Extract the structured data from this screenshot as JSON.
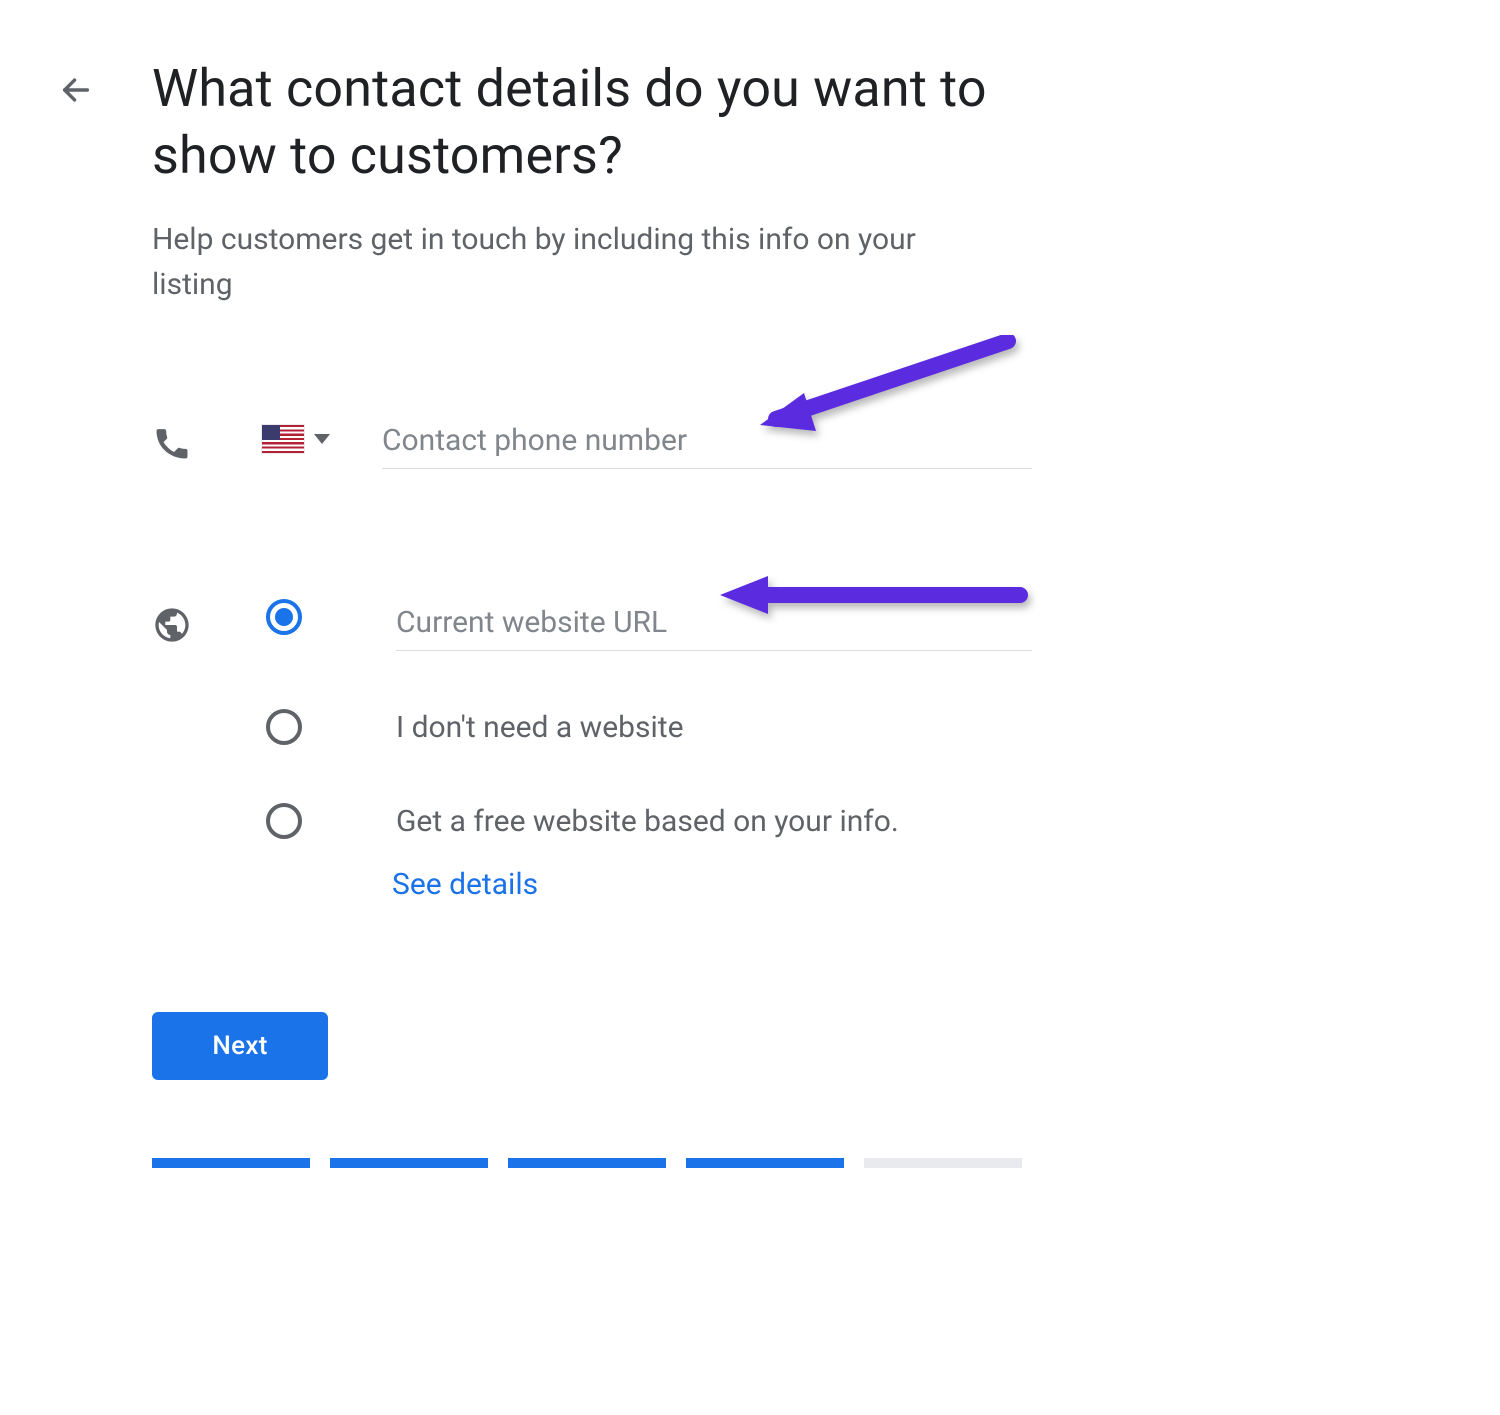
{
  "header": {
    "title": "What contact details do you want to show to customers?",
    "subtitle": "Help customers get in touch by including this info on your listing"
  },
  "phone": {
    "placeholder": "Contact phone number",
    "value": "",
    "country_code": "US"
  },
  "website": {
    "options": [
      {
        "id": "current-url",
        "placeholder": "Current website URL",
        "value": "",
        "selected": true
      },
      {
        "id": "no-website",
        "label": "I don't need a website",
        "selected": false
      },
      {
        "id": "free-website",
        "label": "Get a free website based on your info.",
        "selected": false
      }
    ],
    "see_details_label": "See details"
  },
  "actions": {
    "next_label": "Next"
  },
  "progress": {
    "completed": 4,
    "total": 5
  },
  "colors": {
    "primary": "#1a73e8",
    "text_secondary": "#5f6368",
    "annotation": "#5b2be0"
  }
}
